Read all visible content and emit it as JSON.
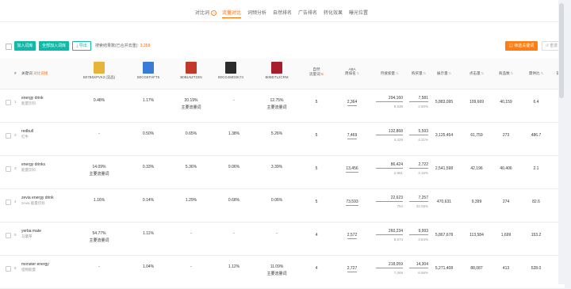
{
  "tabs": [
    {
      "label": "对比词",
      "active": false,
      "help": "?"
    },
    {
      "label": "流量对比",
      "active": true
    },
    {
      "label": "词频分析",
      "active": false
    },
    {
      "label": "自然排名",
      "active": false
    },
    {
      "label": "广告排名",
      "active": false
    },
    {
      "label": "转化效果",
      "active": false
    },
    {
      "label": "曝光位置",
      "active": false
    }
  ],
  "toolbar": {
    "add_label": "加入词库",
    "add_all_label": "全部加入词库",
    "export_label": "导出",
    "summary_label": "搜索结果数(已合并去重):",
    "summary_count": "3,258",
    "filter_label": "筛选关键词",
    "reset_label": "重置"
  },
  "header": {
    "index": "#",
    "keyword": "关键词",
    "keyword_extra": "对比词组",
    "products": [
      {
        "asin": "B07B5XPVK3 (竞品)",
        "color": "#e8b33a"
      },
      {
        "asin": "B0CG6THFT5",
        "color": "#3a7bd5"
      },
      {
        "asin": "B0BLNZT23N",
        "color": "#c0392b"
      },
      {
        "asin": "B0CG4MDSK74",
        "color": "#2c2c2c"
      },
      {
        "asin": "B0BDTL2CRM",
        "color": "#a61e2b"
      }
    ],
    "shared_line1": "自然",
    "shared_line2": "流量词",
    "aba_line1": "ABA",
    "aba_line2": "周排名",
    "monthly_search": "月搜索量",
    "purchases": "购买量",
    "impressions": "展示量",
    "clicks": "点击量",
    "product_count": "商品数",
    "supply_demand": "需供比",
    "action": "操作"
  },
  "rows": [
    {
      "idx": "1",
      "kw": "energy drink",
      "cn": "能量饮料",
      "shares": [
        {
          "v": "0.48%",
          "sub": ""
        },
        {
          "v": "1.17%",
          "sub": ""
        },
        {
          "v": "20.19%",
          "sub": "主要流量词"
        },
        {
          "v": "-",
          "sub": ""
        },
        {
          "v": "12.75%",
          "sub": "主要流量词"
        }
      ],
      "shared": "5",
      "aba": "2,364",
      "search": "294,160",
      "search_sub": "9,538",
      "purchase": "7,581",
      "purchase_sub": "2.90%",
      "impr": "5,883,095",
      "clicks": "109,669",
      "products": "40,159",
      "ratio": "6.4"
    },
    {
      "idx": "2",
      "kw": "redbull",
      "cn": "红牛",
      "shares": [
        {
          "v": "-",
          "sub": ""
        },
        {
          "v": "0.50%",
          "sub": ""
        },
        {
          "v": "0.65%",
          "sub": ""
        },
        {
          "v": "1.38%",
          "sub": ""
        },
        {
          "v": "5.26%",
          "sub": ""
        }
      ],
      "shared": "5",
      "aba": "7,469",
      "search": "132,868",
      "search_sub": "4,429",
      "purchase": "5,593",
      "purchase_sub": "4.21%",
      "impr": "3,125,454",
      "clicks": "61,759",
      "products": "273",
      "ratio": "486.7"
    },
    {
      "idx": "3",
      "kw": "energy drinks",
      "cn": "能量饮料",
      "shares": [
        {
          "v": "14.09%",
          "sub": "主要流量词"
        },
        {
          "v": "0.33%",
          "sub": ""
        },
        {
          "v": "5.36%",
          "sub": ""
        },
        {
          "v": "9.06%",
          "sub": ""
        },
        {
          "v": "3.39%",
          "sub": ""
        }
      ],
      "shared": "5",
      "aba": "13,456",
      "search": "86,424",
      "search_sub": "2,881",
      "purchase": "2,722",
      "purchase_sub": "3.15%",
      "impr": "2,541,598",
      "clicks": "42,196",
      "products": "40,406",
      "ratio": "2.1"
    },
    {
      "idx": "4",
      "kw": "zevia energy drink",
      "cn": "zevia 能量饮料",
      "shares": [
        {
          "v": "1.16%",
          "sub": ""
        },
        {
          "v": "0.14%",
          "sub": ""
        },
        {
          "v": "1.29%",
          "sub": ""
        },
        {
          "v": "0.68%",
          "sub": ""
        },
        {
          "v": "0.06%",
          "sub": ""
        }
      ],
      "shared": "5",
      "aba": "73,593",
      "search": "22,623",
      "search_sub": "754",
      "purchase": "7,257",
      "purchase_sub": "32.08%",
      "impr": "470,631",
      "clicks": "9,399",
      "products": "274",
      "ratio": "82.6"
    },
    {
      "idx": "5",
      "kw": "yerba mate",
      "cn": "马黛茶",
      "shares": [
        {
          "v": "54.77%",
          "sub": "主要流量词"
        },
        {
          "v": "1.11%",
          "sub": ""
        },
        {
          "v": "-",
          "sub": ""
        },
        {
          "v": "-",
          "sub": ""
        },
        {
          "v": "-",
          "sub": ""
        }
      ],
      "shared": "4",
      "aba": "2,572",
      "search": "260,234",
      "search_sub": "8,674",
      "purchase": "9,993",
      "purchase_sub": "3.84%",
      "impr": "5,867,678",
      "clicks": "113,584",
      "products": "1,699",
      "ratio": "153.2"
    },
    {
      "idx": "6",
      "kw": "monster energy",
      "cn": "怪物能量",
      "shares": [
        {
          "v": "-",
          "sub": ""
        },
        {
          "v": "1.04%",
          "sub": ""
        },
        {
          "v": "-",
          "sub": ""
        },
        {
          "v": "1.12%",
          "sub": ""
        },
        {
          "v": "11.09%",
          "sub": "主要流量词"
        }
      ],
      "shared": "4",
      "aba": "2,727",
      "search": "218,059",
      "search_sub": "7,269",
      "purchase": "14,304",
      "purchase_sub": "6.56%",
      "impr": "5,271,408",
      "clicks": "88,087",
      "products": "413",
      "ratio": "528.0"
    }
  ]
}
